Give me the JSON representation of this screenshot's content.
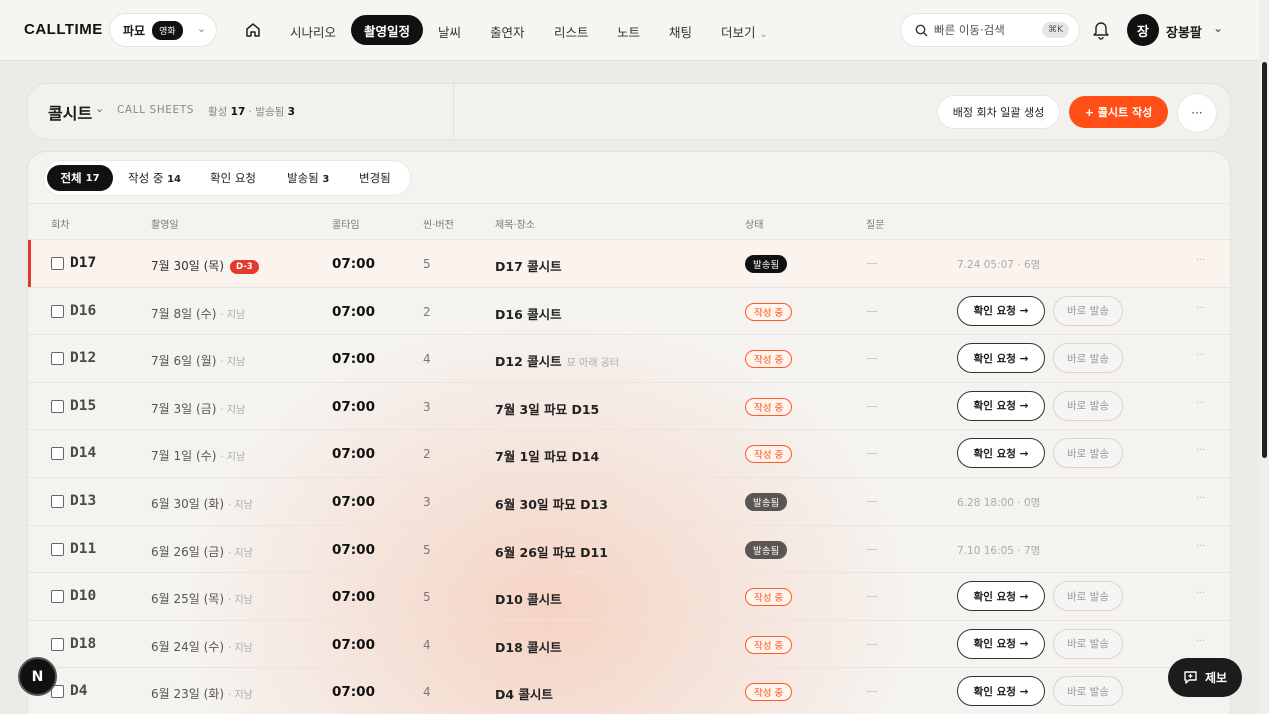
{
  "app": {
    "logo": "CALLTIME"
  },
  "project": {
    "name": "파묘",
    "badge": "영화"
  },
  "nav": {
    "items": [
      "시나리오",
      "촬영일정",
      "날씨",
      "출연자",
      "리스트",
      "노트",
      "채팅",
      "더보기"
    ],
    "active": "촬영일정"
  },
  "search": {
    "placeholder": "빠른 이동·검색",
    "shortcut": "⌘K"
  },
  "user": {
    "avatar_initial": "장",
    "name": "장봉팔"
  },
  "header": {
    "title": "콜시트",
    "subtitle": "CALL SHEETS",
    "active_label": "활성",
    "active_count": "17",
    "sent_label": "· 발송됨",
    "sent_count": "3",
    "batch_button": "배정 회차 일괄 생성",
    "new_button": "+ 콜시트 작성",
    "more_button": "···"
  },
  "tabs": [
    {
      "label": "전체",
      "count": "17"
    },
    {
      "label": "작성 중",
      "count": "14"
    },
    {
      "label": "확인 요청",
      "count": ""
    },
    {
      "label": "발송됨",
      "count": "3"
    },
    {
      "label": "변경됨",
      "count": ""
    }
  ],
  "columns": [
    "회차",
    "촬영일",
    "콜타임",
    "씬·버전",
    "제목·장소",
    "상태",
    "질문"
  ],
  "rows": [
    {
      "code": "D17",
      "date": "7월 30일 (목)",
      "past": "",
      "dday": "D-3",
      "time": "07:00",
      "scene": "5",
      "title": "D17 콜시트",
      "note": "",
      "status": "발송됨",
      "status_kind": "sent",
      "question": "—",
      "meta": "7.24 05:07 · 6명"
    },
    {
      "code": "D16",
      "date": "7월 8일 (수)",
      "past": "· 지남",
      "dday": "",
      "time": "07:00",
      "scene": "2",
      "title": "D16 콜시트",
      "note": "",
      "status": "작성 중",
      "status_kind": "draft",
      "question": "—",
      "meta": ""
    },
    {
      "code": "D12",
      "date": "7월 6일 (월)",
      "past": "· 지남",
      "dday": "",
      "time": "07:00",
      "scene": "4",
      "title": "D12 콜시트",
      "note": "묘 아래 공터",
      "status": "작성 중",
      "status_kind": "draft",
      "question": "—",
      "meta": ""
    },
    {
      "code": "D15",
      "date": "7월 3일 (금)",
      "past": "· 지남",
      "dday": "",
      "time": "07:00",
      "scene": "3",
      "title": "7월 3일 파묘 D15",
      "note": "",
      "status": "작성 중",
      "status_kind": "draft",
      "question": "—",
      "meta": ""
    },
    {
      "code": "D14",
      "date": "7월 1일 (수)",
      "past": "· 지남",
      "dday": "",
      "time": "07:00",
      "scene": "2",
      "title": "7월 1일 파묘 D14",
      "note": "",
      "status": "작성 중",
      "status_kind": "draft",
      "question": "—",
      "meta": ""
    },
    {
      "code": "D13",
      "date": "6월 30일 (화)",
      "past": "· 지남",
      "dday": "",
      "time": "07:00",
      "scene": "3",
      "title": "6월 30일 파묘 D13",
      "note": "",
      "status": "발송됨",
      "status_kind": "sent-muted",
      "question": "—",
      "meta": "6.28 18:00 · 0명"
    },
    {
      "code": "D11",
      "date": "6월 26일 (금)",
      "past": "· 지남",
      "dday": "",
      "time": "07:00",
      "scene": "5",
      "title": "6월 26일 파묘 D11",
      "note": "",
      "status": "발송됨",
      "status_kind": "sent-muted",
      "question": "—",
      "meta": "7.10 16:05 · 7명"
    },
    {
      "code": "D10",
      "date": "6월 25일 (목)",
      "past": "· 지남",
      "dday": "",
      "time": "07:00",
      "scene": "5",
      "title": "D10 콜시트",
      "note": "",
      "status": "작성 중",
      "status_kind": "draft",
      "question": "—",
      "meta": ""
    },
    {
      "code": "D18",
      "date": "6월 24일 (수)",
      "past": "· 지남",
      "dday": "",
      "time": "07:00",
      "scene": "4",
      "title": "D18 콜시트",
      "note": "",
      "status": "작성 중",
      "status_kind": "draft",
      "question": "—",
      "meta": ""
    },
    {
      "code": "D4",
      "date": "6월 23일 (화)",
      "past": "· 지남",
      "dday": "",
      "time": "07:00",
      "scene": "4",
      "title": "D4 콜시트",
      "note": "",
      "status": "작성 중",
      "status_kind": "draft",
      "question": "—",
      "meta": ""
    }
  ],
  "row_actions": {
    "confirm": "확인 요청 →",
    "direct": "바로 발송",
    "more": "···"
  },
  "fab": {
    "n_label": "N",
    "report_label": "제보"
  },
  "colors": {
    "accent": "#ff4f17",
    "dday": "#e23a2c",
    "dark": "#111111"
  }
}
